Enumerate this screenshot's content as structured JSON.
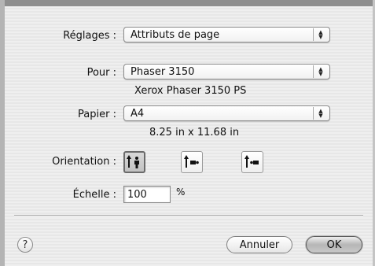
{
  "settings": {
    "label": "Réglages :",
    "value": "Attributs de page"
  },
  "format_for": {
    "label": "Pour :",
    "value": "Phaser 3150",
    "description": "Xerox Phaser 3150 PS"
  },
  "paper": {
    "label": "Papier :",
    "value": "A4",
    "size": "8.25 in x 11.68 in"
  },
  "orientation": {
    "label": "Orientation :",
    "options": [
      {
        "name": "portrait",
        "selected": true
      },
      {
        "name": "landscape-left",
        "selected": false
      },
      {
        "name": "landscape-right",
        "selected": false
      }
    ]
  },
  "scale": {
    "label": "Échelle :",
    "value": "100",
    "unit": "%"
  },
  "buttons": {
    "help": "?",
    "cancel": "Annuler",
    "ok": "OK"
  }
}
